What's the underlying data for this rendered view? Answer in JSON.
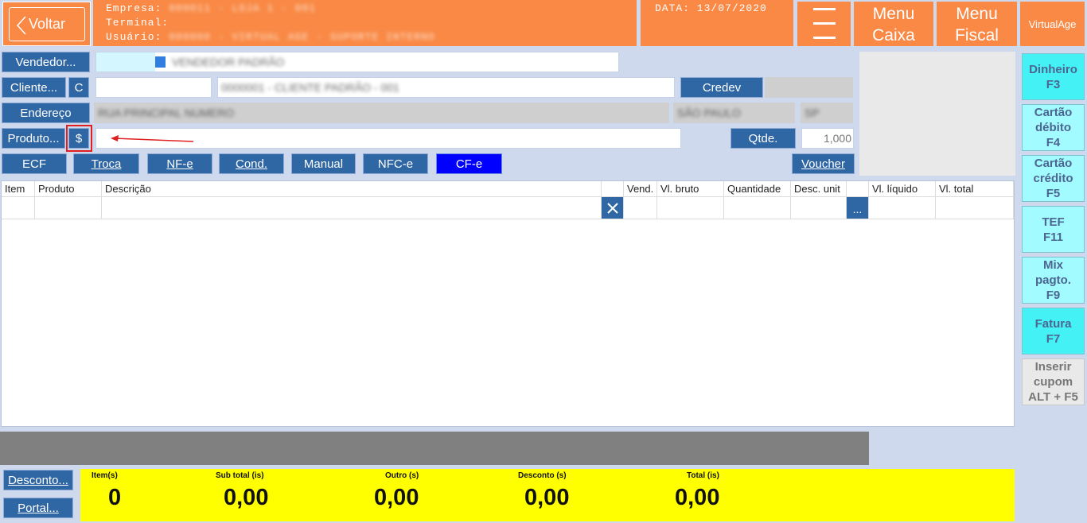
{
  "header": {
    "back_label": "Voltar",
    "empresa_label": "Empresa:",
    "empresa_value": "000011 - LOJA 1 - 001",
    "terminal_label": "Terminal:",
    "usuario_label": "Usuário:",
    "usuario_value": "000000 - VIRTUAL AGE - SUPORTE INTERNO",
    "date_text": "DATA: 13/07/2020",
    "menu_caixa": [
      "Menu",
      "Caixa"
    ],
    "menu_fiscal": [
      "Menu",
      "Fiscal"
    ],
    "brand": "VirtualAge"
  },
  "form": {
    "vendedor_button": "Vendedor...",
    "vendedor_name": "VENDEDOR PADRÃO",
    "cliente_button": "Cliente...",
    "cliente_c_button": "C",
    "cliente_name": "0000001 - CLIENTE PADRÃO - 001",
    "credev_button": "Credev",
    "endereco_button": "Endereço",
    "endereco_value": "RUA PRINCIPAL NUMERO",
    "cidade_value": "SÃO PAULO",
    "uf_value": "SP",
    "produto_button": "Produto...",
    "price_button": "$",
    "qtde_button": "Qtde.",
    "qtde_value": "1,000"
  },
  "modes": [
    "ECF",
    "Troca",
    "NF-e",
    "Cond.",
    "Manual",
    "NFC-e",
    "CF-e"
  ],
  "voucher_button": "Voucher",
  "side_buttons": [
    [
      "Dinheiro",
      "F3"
    ],
    [
      "Cartão",
      "débito",
      "F4"
    ],
    [
      "Cartão",
      "crédito",
      "F5"
    ],
    [
      "TEF",
      "F11"
    ],
    [
      "Mix",
      "pagto.",
      "F9"
    ],
    [
      "Fatura",
      "F7"
    ],
    [
      "Inserir",
      "cupom",
      "ALT + F5"
    ]
  ],
  "table": {
    "columns": [
      "Item",
      "Produto",
      "Descrição",
      "",
      "Vend.",
      "Vl. bruto",
      "Quantidade",
      "Desc. unit",
      "",
      "Vl. líquido",
      "Vl. total"
    ],
    "ellipsis": "..."
  },
  "footer": {
    "desconto_button": "Desconto...",
    "portal_button": "Portal...",
    "totals": [
      {
        "label": "Item(s)",
        "value": "0"
      },
      {
        "label": "Sub total (is)",
        "value": "0,00"
      },
      {
        "label": "Outro (s)",
        "value": "0,00"
      },
      {
        "label": "Desconto (s)",
        "value": "0,00"
      },
      {
        "label": "Total (is)",
        "value": "0,00"
      }
    ]
  },
  "colors": {
    "header_orange": "#f98945",
    "button_blue": "#2f66a4",
    "cfe_blue": "#0000ff",
    "side_cyan": "#a2fcff",
    "totals_yellow": "#ffff00",
    "highlight_red": "#e02020"
  }
}
